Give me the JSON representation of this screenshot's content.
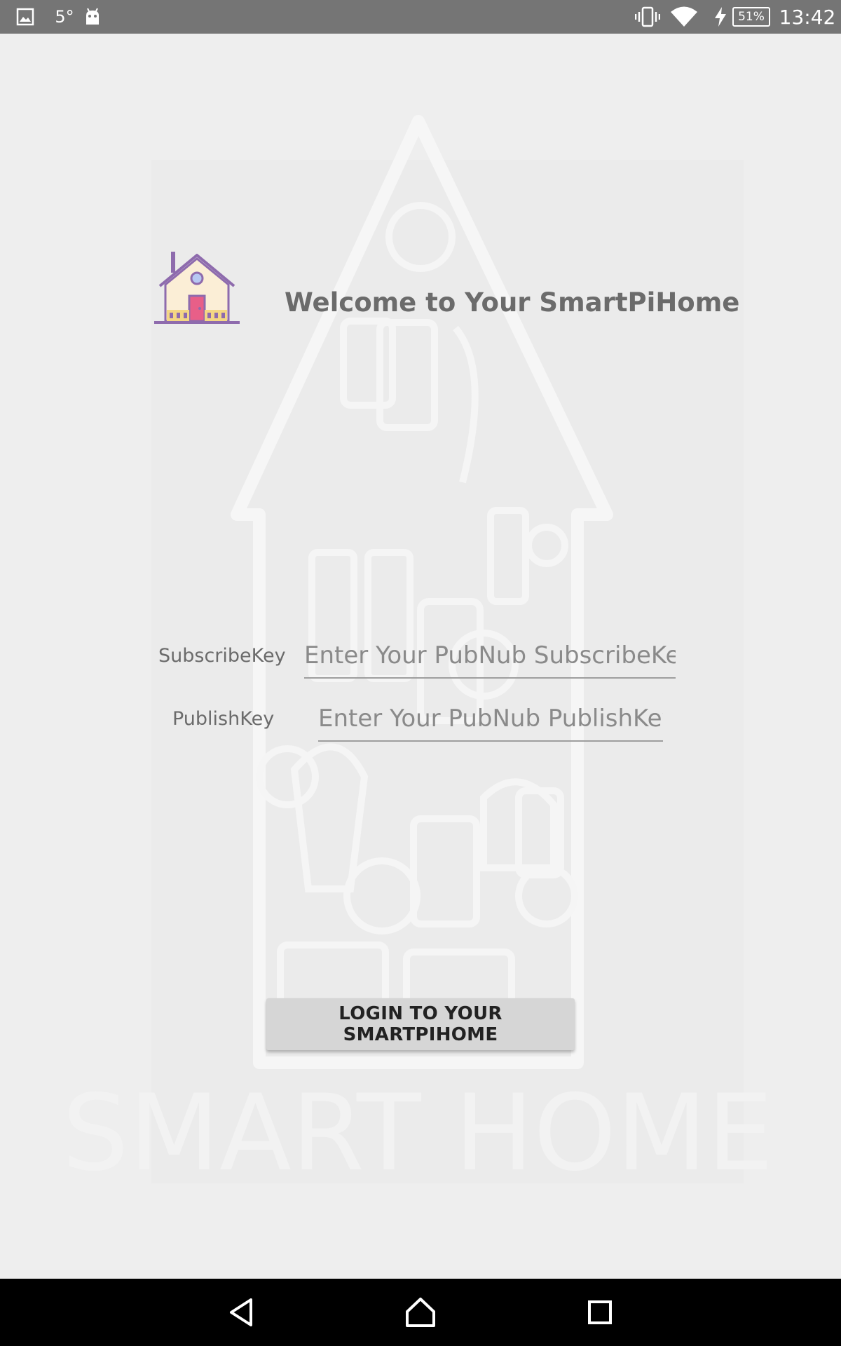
{
  "status_bar": {
    "left_icons": [
      "gallery-icon",
      "android-icon"
    ],
    "temperature": "5°",
    "right_icons": [
      "vibrate-icon",
      "wifi-icon",
      "charging-icon"
    ],
    "battery_percent": "51%",
    "time": "13:42"
  },
  "app": {
    "welcome_title": "Welcome to Your SmartPiHome",
    "subscribe": {
      "label": "SubscribeKey",
      "value": "",
      "placeholder": "Enter Your PubNub SubscribeKey"
    },
    "publish": {
      "label": "PublishKey",
      "value": "",
      "placeholder": "Enter Your PubNub PublishKey"
    },
    "login_button": "LOGIN TO YOUR SMARTPIHOME",
    "watermark_text": "SMART HOME"
  },
  "nav_bar": {
    "buttons": [
      "back-icon",
      "home-icon",
      "recents-icon"
    ]
  },
  "colors": {
    "status_bar": "#757575",
    "background": "#eeeeee",
    "text": "#6b6b6b",
    "button": "#d6d6d6",
    "nav_bar": "#000000"
  }
}
